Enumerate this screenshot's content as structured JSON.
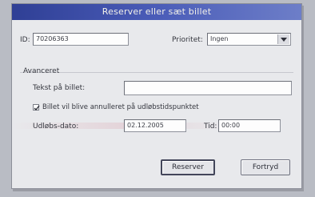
{
  "dialog": {
    "title": "Reserver eller sæt billet"
  },
  "id_row": {
    "id_label": "ID:",
    "id_value": "70206363",
    "priority_label": "Prioritet:",
    "priority_value": "Ingen"
  },
  "advanced": {
    "heading": "Avanceret",
    "text_label": "Tekst på billet:",
    "text_value": "",
    "checkbox_label": "Billet vil blive annulleret på udløbstidspunktet",
    "checkbox_checked": true,
    "expiry_date_label": "Udløbs-dato:",
    "expiry_date_value": "02.12.2005",
    "time_label": "Tid:",
    "time_value": "00:00"
  },
  "buttons": {
    "reserve_label": "Reserver",
    "cancel_label": "Fortryd"
  },
  "colors": {
    "titlebar": "#2f3f95",
    "dialog_bg": "#e8e9ec",
    "backdrop": "#b9bcc4"
  }
}
